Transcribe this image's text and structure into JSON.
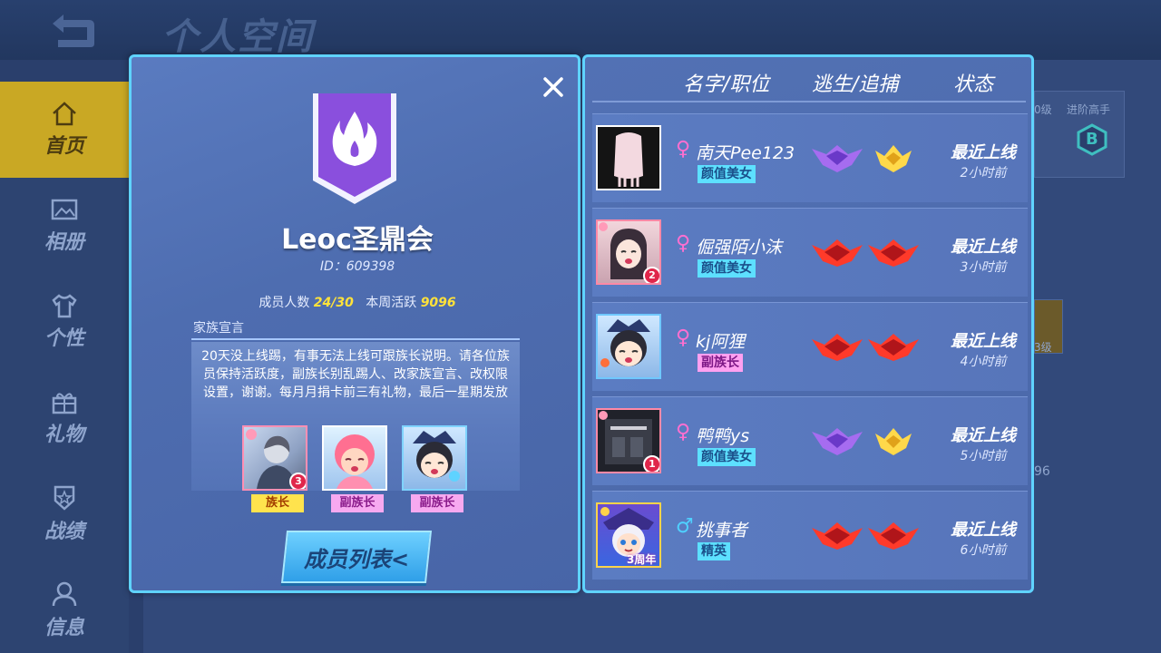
{
  "app": {
    "page_title": "个人空间"
  },
  "sidebar": {
    "items": [
      {
        "label": "首页",
        "icon": "home-icon",
        "active": true
      },
      {
        "label": "相册",
        "icon": "album-icon",
        "active": false
      },
      {
        "label": "个性",
        "icon": "shirt-icon",
        "active": false
      },
      {
        "label": "礼物",
        "icon": "gift-icon",
        "active": false
      },
      {
        "label": "战绩",
        "icon": "medal-icon",
        "active": false
      },
      {
        "label": "信息",
        "icon": "user-icon",
        "active": false
      }
    ]
  },
  "background": {
    "badge_label": "进阶高手",
    "badge_letter": "B",
    "level_text": "0级",
    "number_text": "96",
    "level_text_2": "3级"
  },
  "clan": {
    "name": "Leoc圣鼎会",
    "id_text": "ID：609398",
    "members_label": "成员人数",
    "members_value": "24/30",
    "activity_label": "本周活跃",
    "activity_value": "9096",
    "declaration_title": "家族宣言",
    "declaration": "20天没上线踢，有事无法上线可跟族长说明。请各位族员保持活跃度，副族长别乱踢人、改家族宣言、改权限设置，谢谢。每月月捐卡前三有礼物，最后一星期发放",
    "officers": [
      {
        "role": "族长",
        "rank": "3",
        "style": "leader"
      },
      {
        "role": "副族长",
        "rank": "",
        "style": "vice"
      },
      {
        "role": "副族长",
        "rank": "",
        "style": "vice"
      }
    ],
    "members_button": "成员列表<"
  },
  "member_list": {
    "headers": [
      "名字/职位",
      "逃生/追捕",
      "状态"
    ],
    "rows": [
      {
        "gender": "♀",
        "name": "南天Pee123",
        "title": "颜值美女",
        "title_style": "cyan",
        "rank_escape": "purple",
        "rank_hunt": "gold",
        "status": "最近上线",
        "time": "2小时前"
      },
      {
        "gender": "♀",
        "name": "倔强陌小沫",
        "title": "颜值美女",
        "title_style": "cyan",
        "rank_escape": "red",
        "rank_hunt": "red",
        "status": "最近上线",
        "time": "3小时前"
      },
      {
        "gender": "♀",
        "name": "kj阿狸",
        "title": "副族长",
        "title_style": "pink",
        "rank_escape": "red",
        "rank_hunt": "red",
        "status": "最近上线",
        "time": "4小时前"
      },
      {
        "gender": "♀",
        "name": "鸭鸭ys",
        "title": "颜值美女",
        "title_style": "cyan",
        "rank_escape": "purple",
        "rank_hunt": "gold",
        "status": "最近上线",
        "time": "5小时前"
      },
      {
        "gender": "♂",
        "name": "挑事者",
        "title": "精英",
        "title_style": "cyan",
        "rank_escape": "red",
        "rank_hunt": "red",
        "status": "最近上线",
        "time": "6小时前"
      }
    ],
    "avatar_badges": [
      "",
      "2",
      "",
      "1",
      "3周年"
    ]
  },
  "colors": {
    "accent_cyan": "#5fd3ff",
    "female": "#ff6fd0",
    "male": "#4fd0ff",
    "highlight_yellow": "#ffe23a"
  }
}
